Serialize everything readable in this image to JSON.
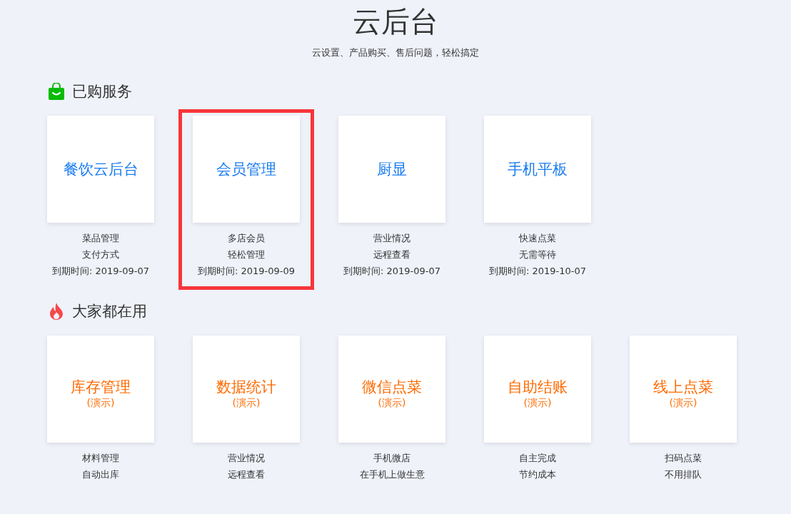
{
  "header": {
    "title": "云后台",
    "subtitle": "云设置、产品购买、售后问题，轻松搞定"
  },
  "sections": [
    {
      "kind": "purchased",
      "title": "已购服务",
      "items": [
        {
          "name": "餐饮云后台",
          "lines": [
            "菜品管理",
            "支付方式"
          ],
          "expiry": "到期时间: 2019-09-07",
          "highlighted": false
        },
        {
          "name": "会员管理",
          "lines": [
            "多店会员",
            "轻松管理"
          ],
          "expiry": "到期时间: 2019-09-09",
          "highlighted": true
        },
        {
          "name": "厨显",
          "lines": [
            "营业情况",
            "远程查看"
          ],
          "expiry": "到期时间: 2019-09-07",
          "highlighted": false
        },
        {
          "name": "手机平板",
          "lines": [
            "快速点菜",
            "无需等待"
          ],
          "expiry": "到期时间: 2019-10-07",
          "highlighted": false
        }
      ]
    },
    {
      "kind": "popular",
      "title": "大家都在用",
      "items": [
        {
          "name": "库存管理",
          "tag": "(演示)",
          "lines": [
            "材料管理",
            "自动出库"
          ],
          "highlighted": false
        },
        {
          "name": "数据统计",
          "tag": "(演示)",
          "lines": [
            "营业情况",
            "远程查看"
          ],
          "highlighted": false
        },
        {
          "name": "微信点菜",
          "tag": "(演示)",
          "lines": [
            "手机微店",
            "在手机上做生意"
          ],
          "highlighted": false
        },
        {
          "name": "自助结账",
          "tag": "(演示)",
          "lines": [
            "自主完成",
            "节约成本"
          ],
          "highlighted": false
        },
        {
          "name": "线上点菜",
          "tag": "(演示)",
          "lines": [
            "扫码点菜",
            "不用排队"
          ],
          "highlighted": false
        }
      ]
    }
  ]
}
